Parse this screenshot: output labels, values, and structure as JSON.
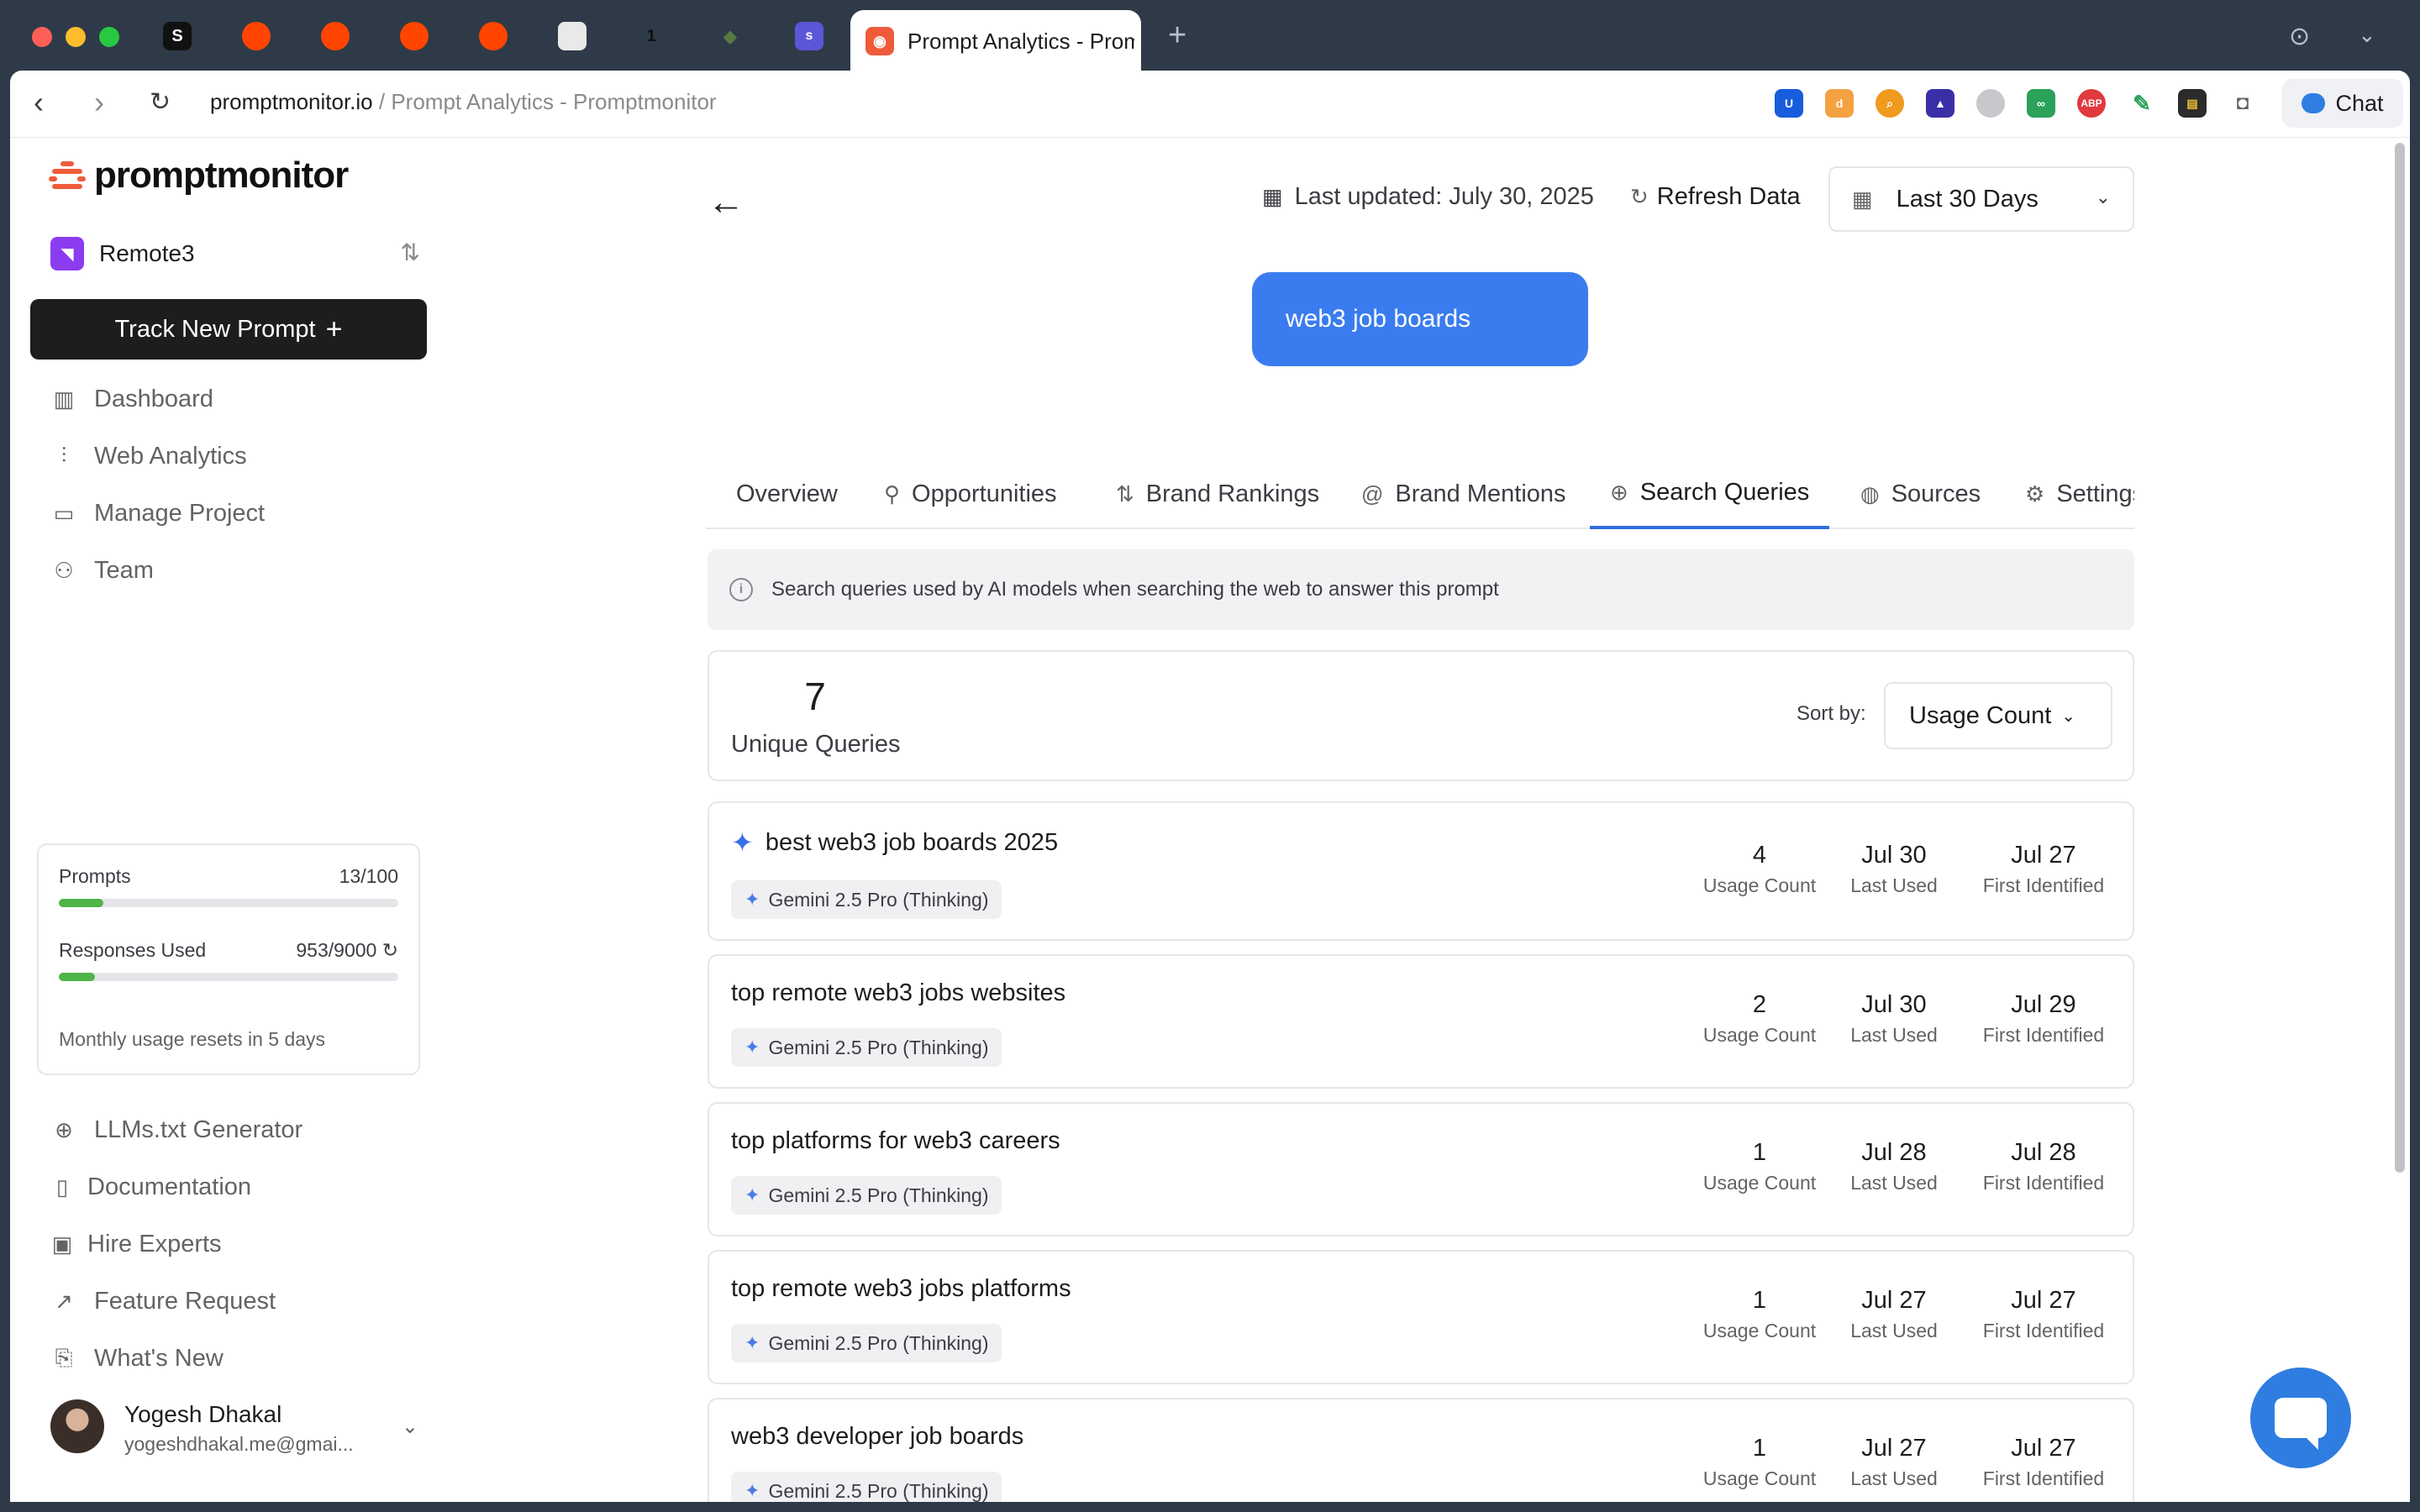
{
  "browser": {
    "active_tab_title": "Prompt Analytics - Promptmonitor",
    "url_domain": "promptmonitor.io",
    "url_rest": " / Prompt Analytics - Promptmonitor",
    "chat_label": "Chat"
  },
  "sidebar": {
    "logo": "promptmonitor",
    "project": "Remote3",
    "track_button": "Track New Prompt",
    "nav": [
      {
        "label": "Dashboard",
        "icon": "dashboard-icon"
      },
      {
        "label": "Web Analytics",
        "icon": "analytics-icon"
      },
      {
        "label": "Manage Project",
        "icon": "folder-icon"
      },
      {
        "label": "Team",
        "icon": "team-icon"
      }
    ],
    "usage": {
      "prompts_label": "Prompts",
      "prompts_value": "13/100",
      "prompts_fraction": 0.13,
      "responses_label": "Responses Used",
      "responses_value": "953/9000",
      "responses_fraction": 0.106,
      "note": "Monthly usage resets in 5 days"
    },
    "bottom_nav": [
      {
        "label": "LLMs.txt Generator",
        "icon": "globe-search-icon"
      },
      {
        "label": "Documentation",
        "icon": "book-icon"
      },
      {
        "label": "Hire Experts",
        "icon": "briefcase-icon"
      },
      {
        "label": "Feature Request",
        "icon": "arrow-up-right-icon"
      },
      {
        "label": "What's New",
        "icon": "file-plus-icon"
      }
    ],
    "user": {
      "name": "Yogesh Dhakal",
      "email": "yogeshdhakal.me@gmai..."
    }
  },
  "header": {
    "last_updated": "Last updated: July 30, 2025",
    "refresh": "Refresh Data",
    "date_range": "Last 30 Days"
  },
  "prompt": "web3 job boards",
  "tabs": [
    {
      "label": "Overview"
    },
    {
      "label": "Opportunities"
    },
    {
      "label": "Brand Rankings"
    },
    {
      "label": "Brand Mentions"
    },
    {
      "label": "Search Queries"
    },
    {
      "label": "Sources"
    },
    {
      "label": "Settings"
    }
  ],
  "active_tab": "Search Queries",
  "info": "Search queries used by AI models when searching the web to answer this prompt",
  "summary": {
    "count": "7",
    "label": "Unique Queries",
    "sort_label": "Sort by:",
    "sort_value": "Usage Count"
  },
  "stat_labels": {
    "usage": "Usage Count",
    "last": "Last Used",
    "first": "First Identified"
  },
  "queries": [
    {
      "text": "best web3 job boards 2025",
      "model": "Gemini 2.5 Pro (Thinking)",
      "usage": "4",
      "last": "Jul 30",
      "first": "Jul 27"
    },
    {
      "text": "top remote web3 jobs websites",
      "model": "Gemini 2.5 Pro (Thinking)",
      "usage": "2",
      "last": "Jul 30",
      "first": "Jul 29"
    },
    {
      "text": "top platforms for web3 careers",
      "model": "Gemini 2.5 Pro (Thinking)",
      "usage": "1",
      "last": "Jul 28",
      "first": "Jul 28"
    },
    {
      "text": "top remote web3 jobs platforms",
      "model": "Gemini 2.5 Pro (Thinking)",
      "usage": "1",
      "last": "Jul 27",
      "first": "Jul 27"
    },
    {
      "text": "web3 developer job boards",
      "model": "Gemini 2.5 Pro (Thinking)",
      "usage": "1",
      "last": "Jul 27",
      "first": "Jul 27"
    }
  ],
  "colors": {
    "accent": "#3a7cf0",
    "brand": "#ef5b3a",
    "progress": "#4fb548"
  }
}
